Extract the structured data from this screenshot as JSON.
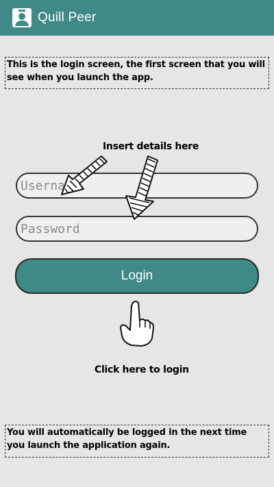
{
  "app_bar": {
    "title": "Quill Peer",
    "color": "#3f8a86",
    "icon": "person-icon"
  },
  "notes": {
    "top": "This is the login screen, the first screen that you will see when you launch the app.",
    "bottom": "You will automatically be logged in the next time you launch the application again."
  },
  "annotations": {
    "insert_details": "Insert details here",
    "click_login": "Click here to login"
  },
  "form": {
    "username_placeholder": "Username",
    "username_value": "",
    "password_placeholder": "Password",
    "password_value": "",
    "login_label": "Login"
  }
}
